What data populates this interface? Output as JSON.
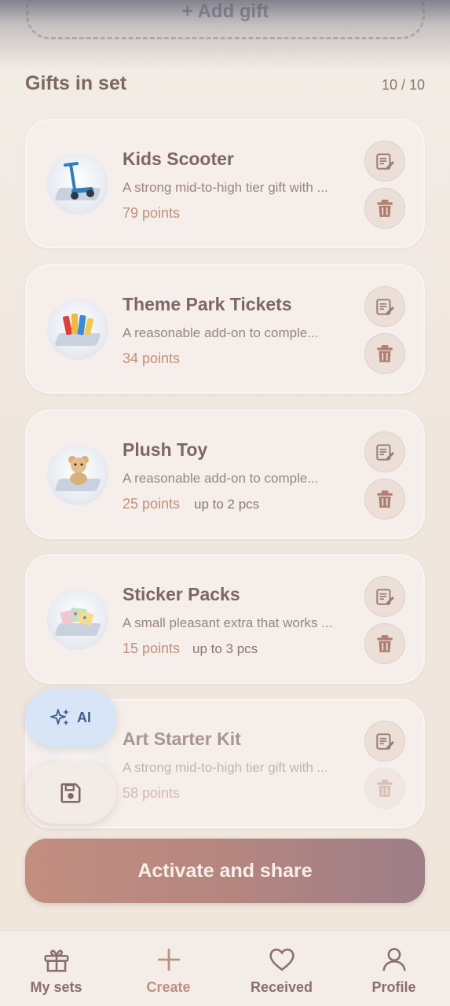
{
  "add_gift": {
    "label": "+ Add gift"
  },
  "section": {
    "title": "Gifts in set",
    "count": "10 / 10"
  },
  "gifts": [
    {
      "title": "Kids Scooter",
      "description": "A strong mid-to-high tier gift with ...",
      "points": "79 points",
      "quantity": ""
    },
    {
      "title": "Theme Park Tickets",
      "description": "A reasonable add-on to comple...",
      "points": "34 points",
      "quantity": ""
    },
    {
      "title": "Plush Toy",
      "description": "A reasonable add-on to comple...",
      "points": "25 points",
      "quantity": "up to 2 pcs"
    },
    {
      "title": "Sticker Packs",
      "description": "A small pleasant extra that works ...",
      "points": "15 points",
      "quantity": "up to 3 pcs"
    },
    {
      "title": "Art Starter Kit",
      "description": "A strong mid-to-high tier gift with ...",
      "points": "58 points",
      "quantity": ""
    }
  ],
  "fab": {
    "ai_label": "AI"
  },
  "activate_button": {
    "label": "Activate and share"
  },
  "nav": {
    "items": [
      {
        "label": "My sets",
        "icon": "gift-icon"
      },
      {
        "label": "Create",
        "icon": "plus-icon"
      },
      {
        "label": "Received",
        "icon": "heart-icon"
      },
      {
        "label": "Profile",
        "icon": "user-icon"
      }
    ],
    "active": "Create"
  },
  "colors": {
    "accent": "#c0907f",
    "text_primary": "#7d6762",
    "card_bg": "#f5eeea",
    "icon_button_bg": "#ebdfd8",
    "ai_fab_bg": "#d8e5f6",
    "activate_gradient_start": "#c28e80",
    "activate_gradient_end": "#9e7e88"
  }
}
